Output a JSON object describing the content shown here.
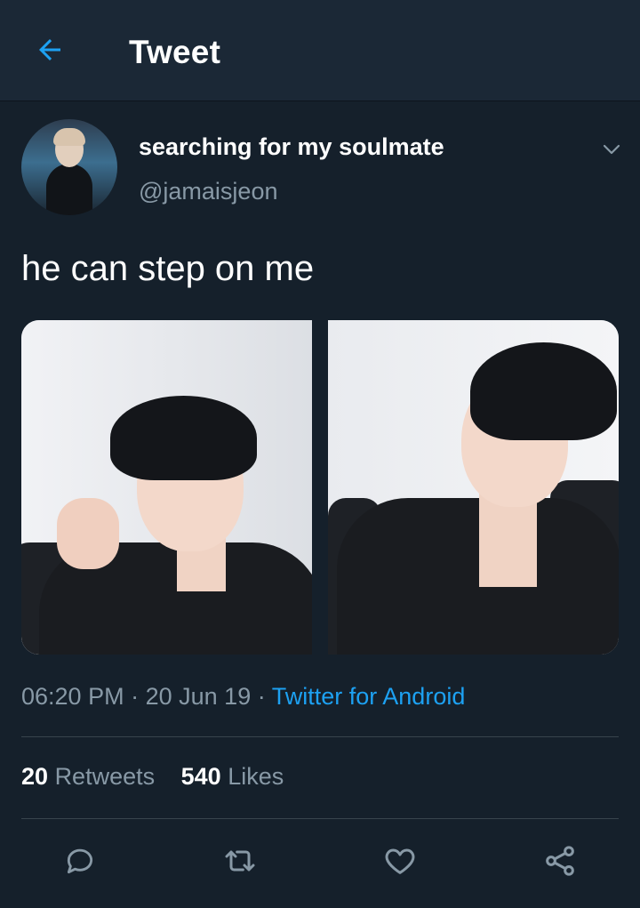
{
  "header": {
    "title": "Tweet",
    "back_icon": "arrow-left-icon",
    "accent_color": "#1da1f2"
  },
  "tweet": {
    "display_name": "searching for my soulmate",
    "handle": "@jamaisjeon",
    "text": "he can step on me",
    "time": "06:20 PM",
    "date": "20 Jun 19",
    "separator": "·",
    "source": "Twitter for Android",
    "media_count": 2
  },
  "stats": {
    "retweets_count": "20",
    "retweets_label": "Retweets",
    "likes_count": "540",
    "likes_label": "Likes"
  },
  "actions": {
    "icons": [
      "reply-icon",
      "retweet-icon",
      "like-icon",
      "share-icon"
    ]
  },
  "colors": {
    "background": "#15202b",
    "header_background": "#1b2836",
    "secondary_text": "#8899a6",
    "divider": "#38444d"
  }
}
